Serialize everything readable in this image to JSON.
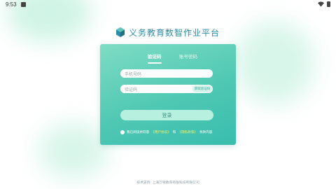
{
  "status_bar": {
    "time": "9:53",
    "icons": [
      "notification-icon",
      "wifi-icon",
      "battery-icon"
    ]
  },
  "brand": {
    "title": "义务教育数智作业平台",
    "logo_icon": "cube-logo-icon",
    "title_color": "#2b8ca6"
  },
  "login_card": {
    "tabs": [
      {
        "label": "验证码",
        "active": true
      },
      {
        "label": "账号密码",
        "active": false
      }
    ],
    "phone_input": {
      "placeholder": "手机号码",
      "value": ""
    },
    "code_input": {
      "placeholder": "验证码",
      "value": ""
    },
    "get_code_label": "获取验证码",
    "login_button_label": "登录",
    "agreement": {
      "prefix": "我已阅读并同意",
      "user_agreement": "《用户协议》",
      "and": "和",
      "privacy_policy": "《隐私政策》",
      "suffix": "条款内容"
    },
    "colors": {
      "gradient_start": "#7fdcc4",
      "gradient_end": "#39bdae",
      "link": "#f7f16a"
    }
  },
  "footer": {
    "support_text": "技术支持: 上海万锐教育有限科技有限公司"
  }
}
